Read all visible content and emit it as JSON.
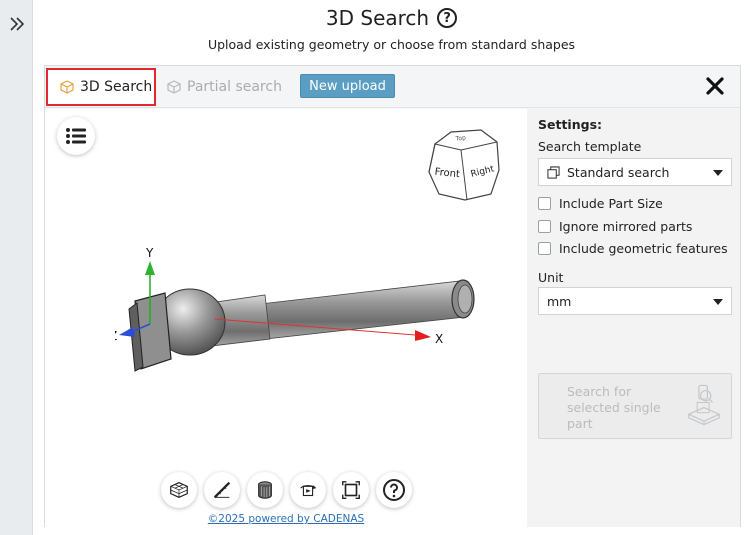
{
  "header": {
    "title": "3D Search",
    "help_symbol": "?",
    "subtitle": "Upload existing geometry or choose from standard shapes"
  },
  "tabs": [
    {
      "label": "3D Search",
      "active": true
    },
    {
      "label": "Partial search",
      "active": false
    }
  ],
  "toolbar": {
    "new_upload_label": "New upload"
  },
  "viewer": {
    "viewcube": {
      "front": "Front",
      "right": "Right",
      "top": "Top"
    },
    "axes": {
      "x": "X",
      "y": "Y",
      "z": "Z"
    },
    "tools": [
      "wireframe-icon",
      "measure-icon",
      "cylinder-shading-icon",
      "rotate-icon",
      "fit-view-icon",
      "help-icon"
    ],
    "powered_by": "©2025 powered by CADENAS"
  },
  "settings": {
    "title": "Settings:",
    "search_template_label": "Search template",
    "search_template_value": "Standard search",
    "checkboxes": [
      {
        "label": "Include Part Size",
        "checked": false
      },
      {
        "label": "Ignore mirrored parts",
        "checked": false
      },
      {
        "label": "Include geometric features",
        "checked": false
      }
    ],
    "unit_label": "Unit",
    "unit_value": "mm",
    "search_button_label": "Search for selected single part"
  },
  "colors": {
    "accent_blue": "#5a9ec3",
    "active_tab_border": "#e0282e",
    "link": "#2a6fb6"
  }
}
